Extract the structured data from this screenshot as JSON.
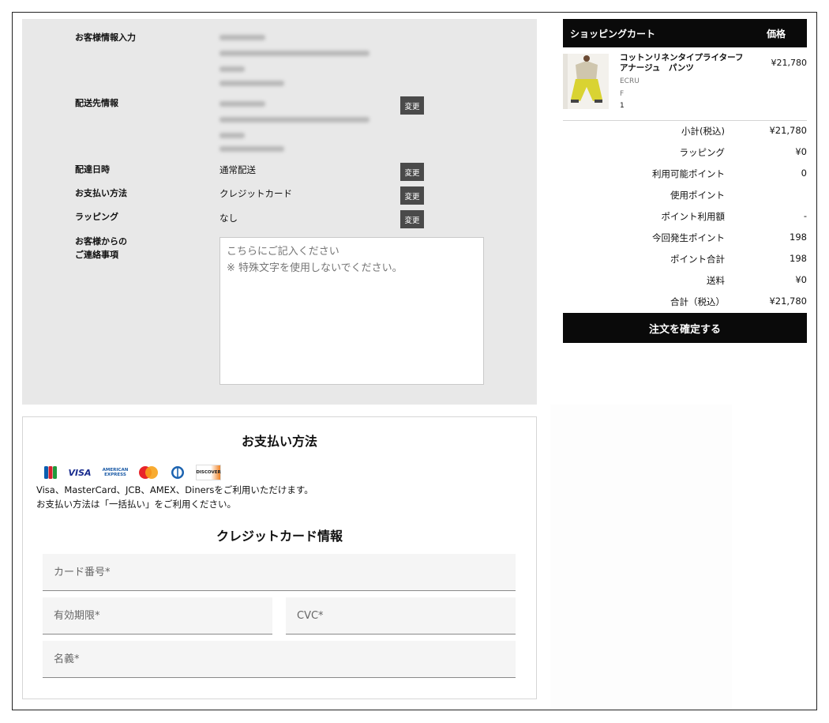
{
  "info": {
    "customer_label": "お客様情報入力",
    "shipping_label": "配送先情報",
    "delivery_label": "配達日時",
    "delivery_value": "通常配送",
    "payment_label": "お支払い方法",
    "payment_value": "クレジットカード",
    "wrapping_label": "ラッピング",
    "wrapping_value": "なし",
    "notes_label_1": "お客様からの",
    "notes_label_2": "ご連絡事項",
    "notes_placeholder": "こちらにご記入ください\n※ 特殊文字を使用しないでください。",
    "change_label": "変更"
  },
  "payment": {
    "title": "お支払い方法",
    "card_brands": [
      "JCB",
      "VISA",
      "AMERICAN EXPRESS",
      "MasterCard",
      "Diners",
      "DISCOVER"
    ],
    "note_1": "Visa、MasterCard、JCB、AMEX、Dinersをご利用いただけます。",
    "note_2": "お支払い方法は「一括払い」をご利用ください。",
    "card_title": "クレジットカード情報",
    "card_number_placeholder": "カード番号*",
    "expiry_placeholder": "有効期限*",
    "cvc_placeholder": "CVC*",
    "name_placeholder": "名義*"
  },
  "cart": {
    "header_title": "ショッピングカート",
    "header_price": "価格",
    "item": {
      "name": "コットンリネンタイプライターフアナージュ　パンツ",
      "color": "ECRU",
      "size": "F",
      "qty": "1",
      "price": "¥21,780"
    },
    "summary": [
      {
        "label": "小計(税込)",
        "value": "¥21,780"
      },
      {
        "label": "ラッピング",
        "value": "¥0"
      },
      {
        "label": "利用可能ポイント",
        "value": "0"
      },
      {
        "label": "使用ポイント",
        "value": ""
      },
      {
        "label": "ポイント利用額",
        "value": "-"
      },
      {
        "label": "今回発生ポイント",
        "value": "198"
      },
      {
        "label": "ポイント合計",
        "value": "198"
      },
      {
        "label": "送料",
        "value": "¥0"
      },
      {
        "label": "合計（税込）",
        "value": "¥21,780"
      }
    ],
    "confirm_label": "注文を確定する"
  }
}
